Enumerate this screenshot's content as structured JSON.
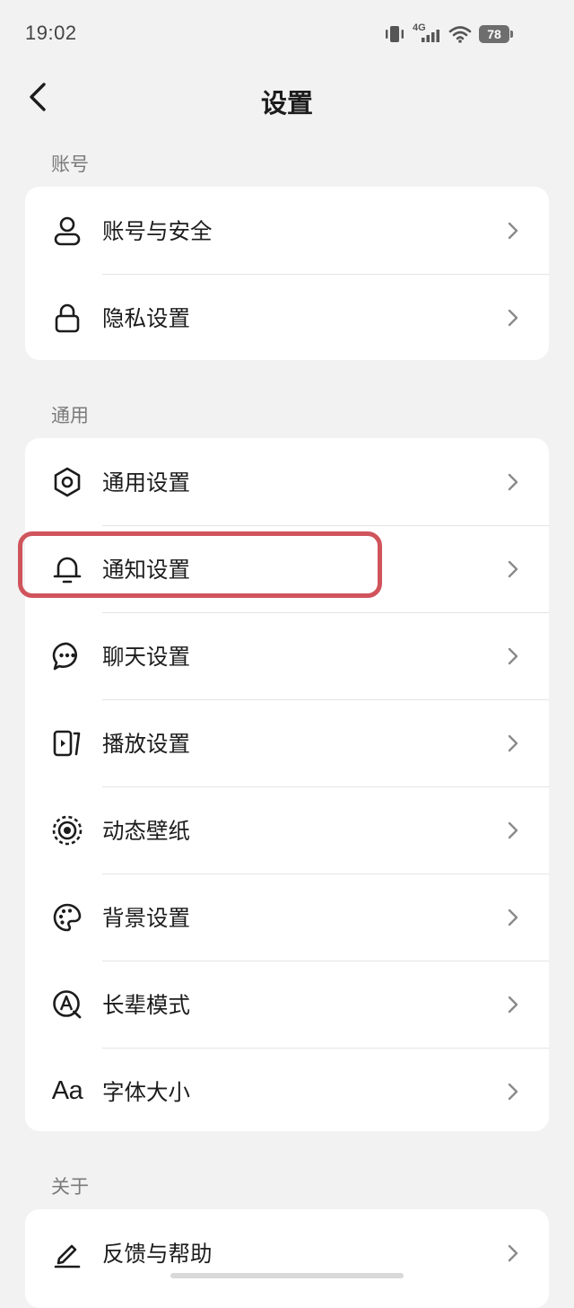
{
  "status_bar": {
    "time": "19:02",
    "network": "4G",
    "battery": "78",
    "icons": [
      "vibrate-icon",
      "signal-icon",
      "wifi-icon",
      "battery-icon"
    ]
  },
  "header": {
    "title": "设置",
    "back_icon": "chevron-left-icon"
  },
  "sections": [
    {
      "label": "账号",
      "items": [
        {
          "label": "账号与安全",
          "icon": "user-icon"
        },
        {
          "label": "隐私设置",
          "icon": "lock-icon"
        }
      ]
    },
    {
      "label": "通用",
      "items": [
        {
          "label": "通用设置",
          "icon": "gear-icon"
        },
        {
          "label": "通知设置",
          "icon": "bell-icon",
          "highlighted": true
        },
        {
          "label": "聊天设置",
          "icon": "chat-bubble-icon"
        },
        {
          "label": "播放设置",
          "icon": "play-screen-icon"
        },
        {
          "label": "动态壁纸",
          "icon": "live-wallpaper-icon"
        },
        {
          "label": "背景设置",
          "icon": "palette-icon"
        },
        {
          "label": "长辈模式",
          "icon": "elder-mode-icon"
        },
        {
          "label": "字体大小",
          "icon": "font-size-icon",
          "glyph": "Aa"
        }
      ]
    },
    {
      "label": "关于",
      "items": [
        {
          "label": "反馈与帮助",
          "icon": "edit-pen-icon"
        }
      ]
    }
  ],
  "colors": {
    "background": "#f2f2f2",
    "card": "#ffffff",
    "highlight": "#d0545c",
    "section_label": "#7a7a7a"
  }
}
